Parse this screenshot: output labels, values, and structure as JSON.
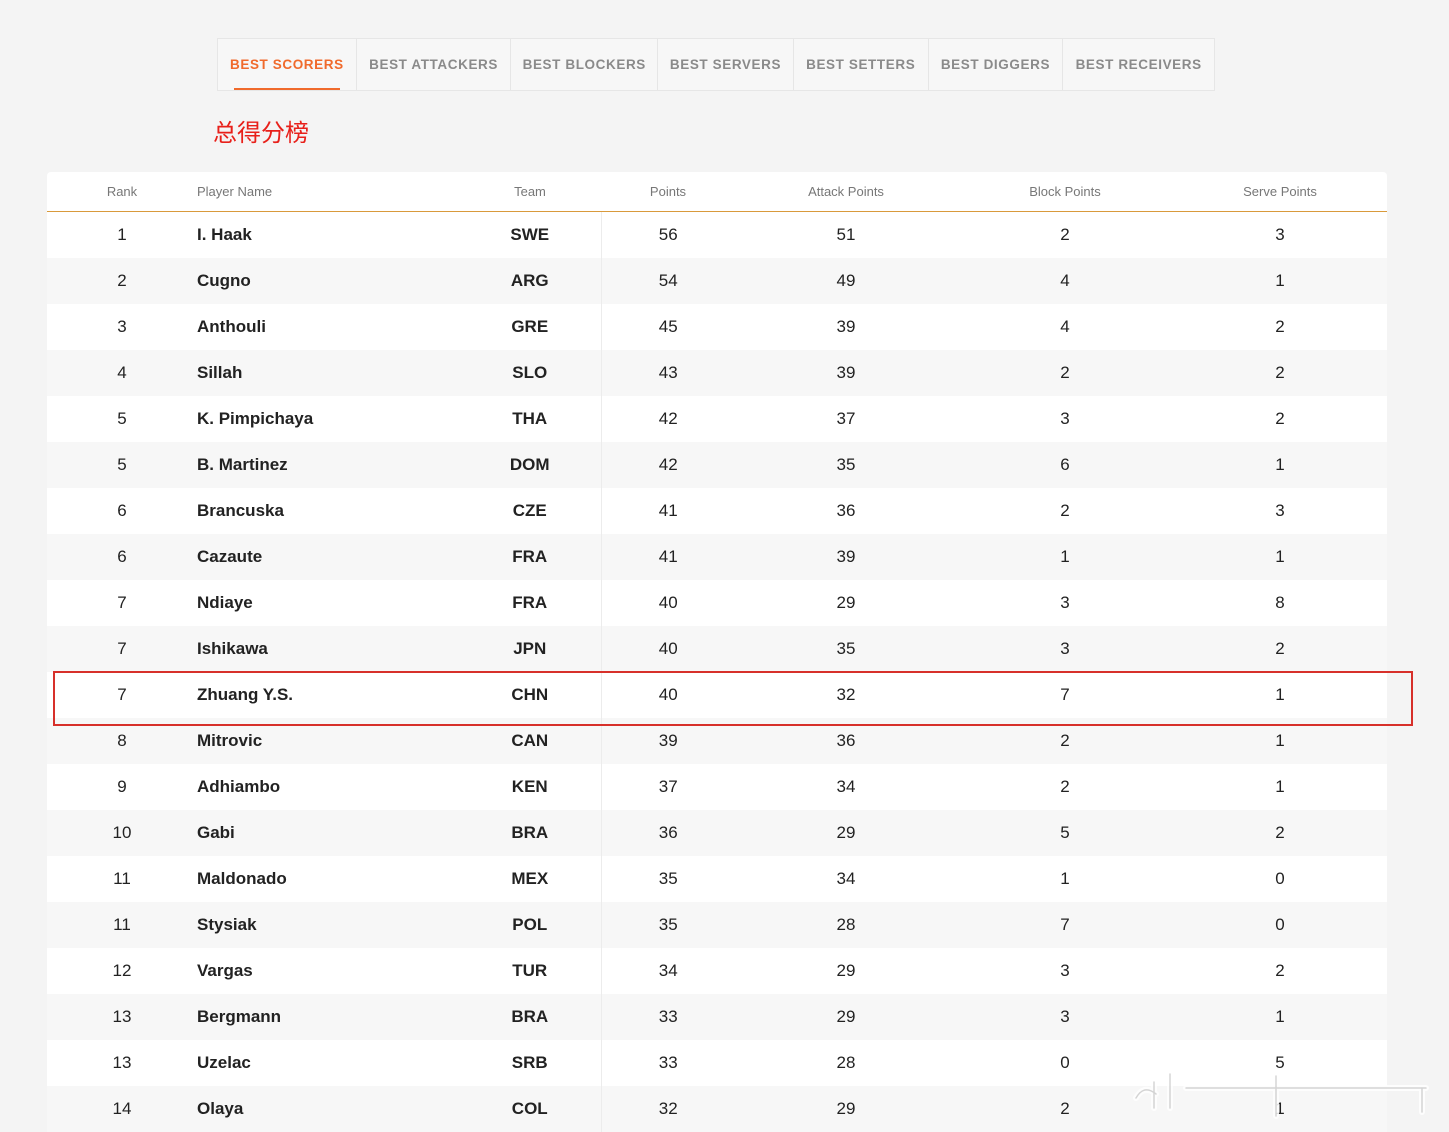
{
  "tabs": [
    {
      "label": "BEST SCORERS",
      "active": true
    },
    {
      "label": "BEST ATTACKERS",
      "active": false
    },
    {
      "label": "BEST BLOCKERS",
      "active": false
    },
    {
      "label": "BEST SERVERS",
      "active": false
    },
    {
      "label": "BEST SETTERS",
      "active": false
    },
    {
      "label": "BEST DIGGERS",
      "active": false
    },
    {
      "label": "BEST RECEIVERS",
      "active": false
    }
  ],
  "page_title": "总得分榜",
  "columns": [
    "Rank",
    "Player Name",
    "Team",
    "Points",
    "Attack Points",
    "Block Points",
    "Serve Points"
  ],
  "rows": [
    {
      "rank": "1",
      "name": "I. Haak",
      "team": "SWE",
      "points": "56",
      "attack": "51",
      "block": "2",
      "serve": "3"
    },
    {
      "rank": "2",
      "name": "Cugno",
      "team": "ARG",
      "points": "54",
      "attack": "49",
      "block": "4",
      "serve": "1"
    },
    {
      "rank": "3",
      "name": "Anthouli",
      "team": "GRE",
      "points": "45",
      "attack": "39",
      "block": "4",
      "serve": "2"
    },
    {
      "rank": "4",
      "name": "Sillah",
      "team": "SLO",
      "points": "43",
      "attack": "39",
      "block": "2",
      "serve": "2"
    },
    {
      "rank": "5",
      "name": "K. Pimpichaya",
      "team": "THA",
      "points": "42",
      "attack": "37",
      "block": "3",
      "serve": "2"
    },
    {
      "rank": "5",
      "name": "B. Martinez",
      "team": "DOM",
      "points": "42",
      "attack": "35",
      "block": "6",
      "serve": "1"
    },
    {
      "rank": "6",
      "name": "Brancuska",
      "team": "CZE",
      "points": "41",
      "attack": "36",
      "block": "2",
      "serve": "3"
    },
    {
      "rank": "6",
      "name": "Cazaute",
      "team": "FRA",
      "points": "41",
      "attack": "39",
      "block": "1",
      "serve": "1"
    },
    {
      "rank": "7",
      "name": "Ndiaye",
      "team": "FRA",
      "points": "40",
      "attack": "29",
      "block": "3",
      "serve": "8"
    },
    {
      "rank": "7",
      "name": "Ishikawa",
      "team": "JPN",
      "points": "40",
      "attack": "35",
      "block": "3",
      "serve": "2"
    },
    {
      "rank": "7",
      "name": "Zhuang Y.S.",
      "team": "CHN",
      "points": "40",
      "attack": "32",
      "block": "7",
      "serve": "1"
    },
    {
      "rank": "8",
      "name": "Mitrovic",
      "team": "CAN",
      "points": "39",
      "attack": "36",
      "block": "2",
      "serve": "1"
    },
    {
      "rank": "9",
      "name": "Adhiambo",
      "team": "KEN",
      "points": "37",
      "attack": "34",
      "block": "2",
      "serve": "1"
    },
    {
      "rank": "10",
      "name": "Gabi",
      "team": "BRA",
      "points": "36",
      "attack": "29",
      "block": "5",
      "serve": "2"
    },
    {
      "rank": "11",
      "name": "Maldonado",
      "team": "MEX",
      "points": "35",
      "attack": "34",
      "block": "1",
      "serve": "0"
    },
    {
      "rank": "11",
      "name": "Stysiak",
      "team": "POL",
      "points": "35",
      "attack": "28",
      "block": "7",
      "serve": "0"
    },
    {
      "rank": "12",
      "name": "Vargas",
      "team": "TUR",
      "points": "34",
      "attack": "29",
      "block": "3",
      "serve": "2"
    },
    {
      "rank": "13",
      "name": "Bergmann",
      "team": "BRA",
      "points": "33",
      "attack": "29",
      "block": "3",
      "serve": "1"
    },
    {
      "rank": "13",
      "name": "Uzelac",
      "team": "SRB",
      "points": "33",
      "attack": "28",
      "block": "0",
      "serve": "5"
    },
    {
      "rank": "14",
      "name": "Olaya",
      "team": "COL",
      "points": "32",
      "attack": "29",
      "block": "2",
      "serve": "1"
    }
  ],
  "colors": {
    "accent": "#f06a2c",
    "header_rule": "#d99a3b",
    "highlight": "#d7302a",
    "title": "#e8201a"
  }
}
